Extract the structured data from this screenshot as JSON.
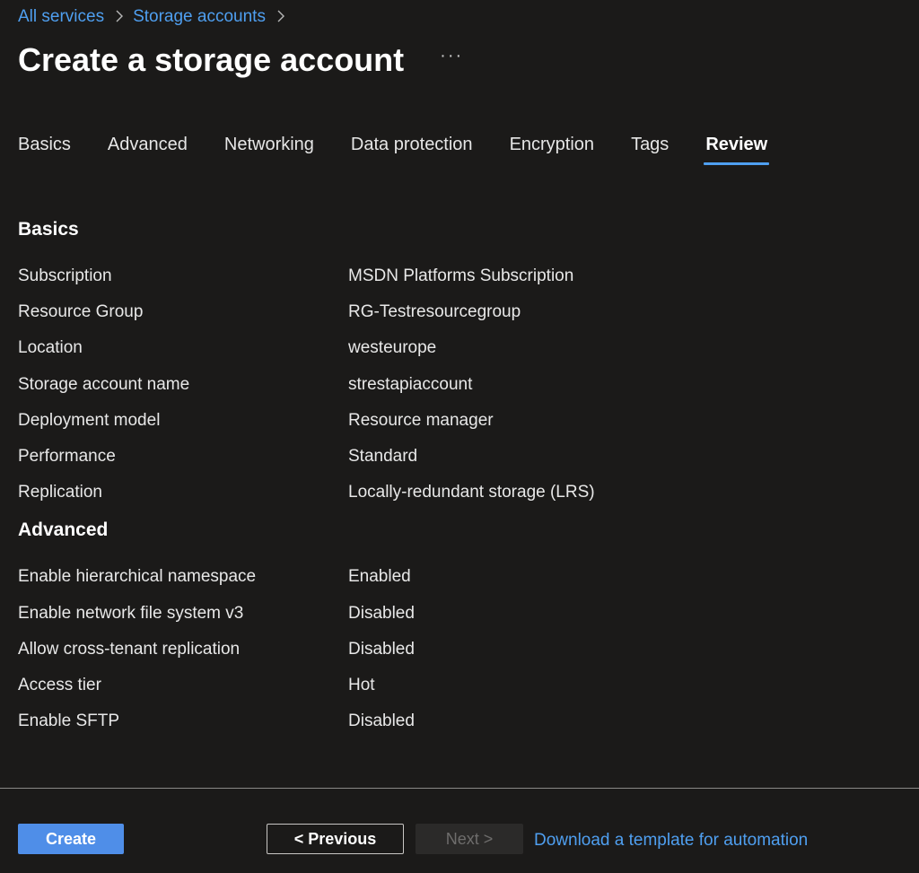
{
  "breadcrumb": {
    "items": [
      "All services",
      "Storage accounts"
    ]
  },
  "header": {
    "title": "Create a storage account",
    "more_label": "···"
  },
  "tabs": [
    {
      "label": "Basics"
    },
    {
      "label": "Advanced"
    },
    {
      "label": "Networking"
    },
    {
      "label": "Data protection"
    },
    {
      "label": "Encryption"
    },
    {
      "label": "Tags"
    },
    {
      "label": "Review",
      "active": true
    }
  ],
  "review": {
    "basics": {
      "title": "Basics",
      "rows": [
        {
          "label": "Subscription",
          "value": "MSDN Platforms Subscription"
        },
        {
          "label": "Resource Group",
          "value": "RG-Testresourcegroup"
        },
        {
          "label": "Location",
          "value": "westeurope"
        },
        {
          "label": "Storage account name",
          "value": "strestapiaccount"
        },
        {
          "label": "Deployment model",
          "value": "Resource manager"
        },
        {
          "label": "Performance",
          "value": "Standard"
        },
        {
          "label": "Replication",
          "value": "Locally-redundant storage (LRS)"
        }
      ]
    },
    "advanced": {
      "title": "Advanced",
      "rows": [
        {
          "label": "Enable hierarchical namespace",
          "value": "Enabled"
        },
        {
          "label": "Enable network file system v3",
          "value": "Disabled"
        },
        {
          "label": "Allow cross-tenant replication",
          "value": "Disabled"
        },
        {
          "label": "Access tier",
          "value": "Hot"
        },
        {
          "label": "Enable SFTP",
          "value": "Disabled"
        }
      ]
    }
  },
  "footer": {
    "create_label": "Create",
    "previous_label": "< Previous",
    "next_label": "Next >",
    "template_link": "Download a template for automation"
  },
  "colors": {
    "background": "#1b1a19",
    "accent": "#4f9ff0",
    "primary_button": "#4f8ee8"
  },
  "icons": {
    "breadcrumb_separator": "chevron-right-icon",
    "more": "ellipsis-icon"
  }
}
